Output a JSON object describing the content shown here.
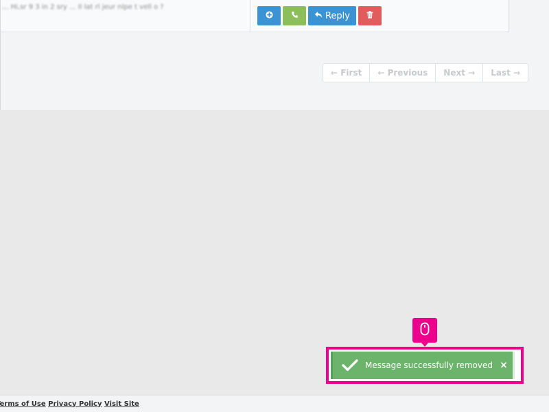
{
  "table": {
    "row_preview_text": "... Hi,sr 9 3 in 2 sry ... Il lat rl jeur nlpe t vell o  ?"
  },
  "row_actions": {
    "add_icon": "plus-circle-icon",
    "call_icon": "phone-icon",
    "reply_label": "Reply",
    "reply_icon": "reply-icon",
    "delete_icon": "trash-icon"
  },
  "pagination": {
    "first": "← First",
    "previous": "← Previous",
    "next": "Next →",
    "last": "Last →"
  },
  "toast": {
    "message": "Message successfully removed",
    "icon": "checkmark-icon",
    "close": "×"
  },
  "cursor": {
    "icon": "mouse-icon"
  },
  "footer": {
    "terms": "Terms of Use",
    "privacy": "Privacy Policy",
    "visit": "Visit Site"
  },
  "colors": {
    "primary_button": "#3b93d4",
    "success_button": "#8cbf5c",
    "danger_button": "#e15c5c",
    "toast_bg": "#6cb36b",
    "highlight": "#ec008c"
  }
}
